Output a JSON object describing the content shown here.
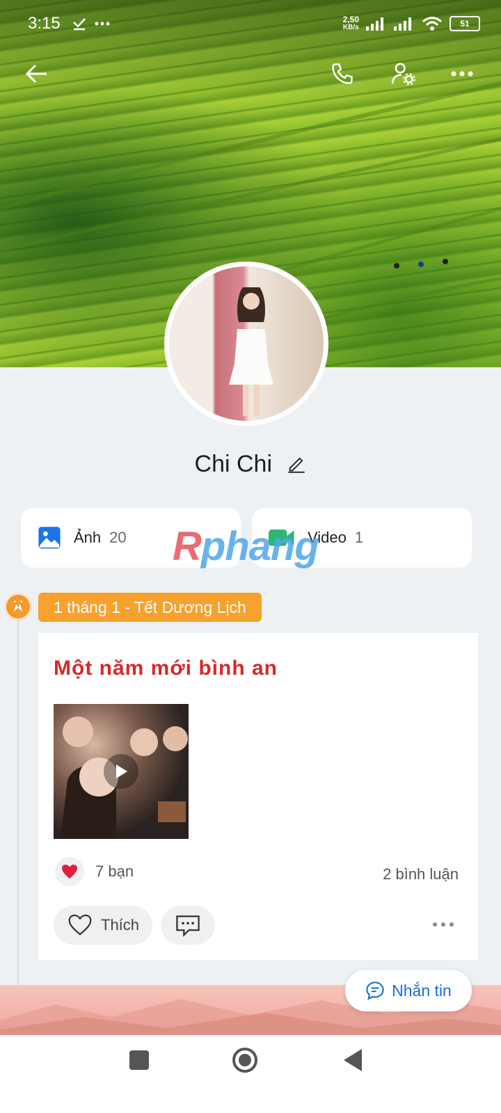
{
  "status_bar": {
    "time": "3:15",
    "net_speed_value": "2,50",
    "net_speed_unit": "KB/s",
    "battery": "51"
  },
  "header_icons": [
    "back-arrow-icon",
    "phone-icon",
    "profile-settings-icon",
    "more-dots-icon"
  ],
  "profile": {
    "name": "Chi Chi"
  },
  "media_cards": [
    {
      "label": "Ảnh",
      "count": "20",
      "icon": "image-icon",
      "color": "#1a73e8"
    },
    {
      "label": "Video",
      "count": "1",
      "icon": "video-camera-icon",
      "color": "#2bb673"
    }
  ],
  "watermark": {
    "part1": "R",
    "part2": "phang"
  },
  "timeline": {
    "tag": "1 tháng 1 - Tết Dương Lịch",
    "tag_color": "#f7a12f"
  },
  "post": {
    "title": "Một năm mới bình an",
    "reactions": "7 bạn",
    "comments": "2 bình luận",
    "like_label": "Thích"
  },
  "message_button": {
    "label": "Nhắn tin",
    "color": "#1a6fd0"
  },
  "nav": [
    "recent-apps-icon",
    "home-icon",
    "back-icon"
  ]
}
